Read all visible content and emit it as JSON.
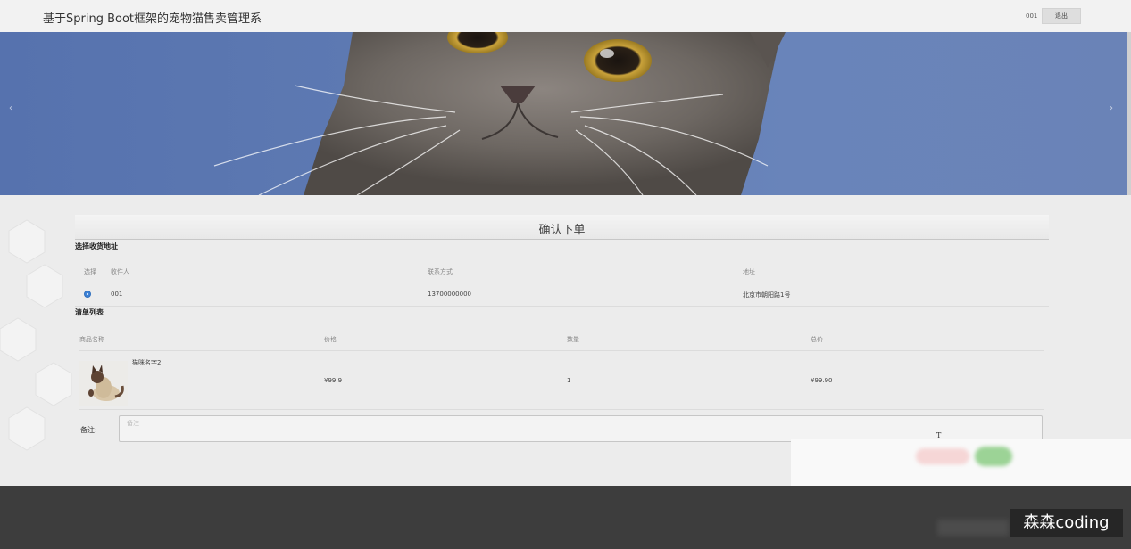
{
  "header": {
    "title": "基于Spring Boot框架的宠物猫售卖管理系",
    "username": "001",
    "logout_label": "退出"
  },
  "banner": {
    "prev_icon": "‹",
    "next_icon": "›"
  },
  "page": {
    "heading": "确认下单"
  },
  "address_section": {
    "label": "选择收货地址",
    "columns": [
      "选择",
      "收件人",
      "联系方式",
      "地址"
    ],
    "rows": [
      {
        "recipient": "001",
        "phone": "13700000000",
        "address": "北京市朝阳路1号",
        "selected": true
      }
    ]
  },
  "order_section": {
    "label": "清单列表",
    "columns": [
      "商品名称",
      "价格",
      "数量",
      "总价"
    ],
    "items": [
      {
        "name": "猫咪名字2",
        "price": "¥99.9",
        "quantity": "1",
        "total": "¥99.90"
      }
    ]
  },
  "remark": {
    "label": "备注:",
    "placeholder": "备注"
  },
  "cursor_glyph": "T",
  "watermark": "森森coding"
}
